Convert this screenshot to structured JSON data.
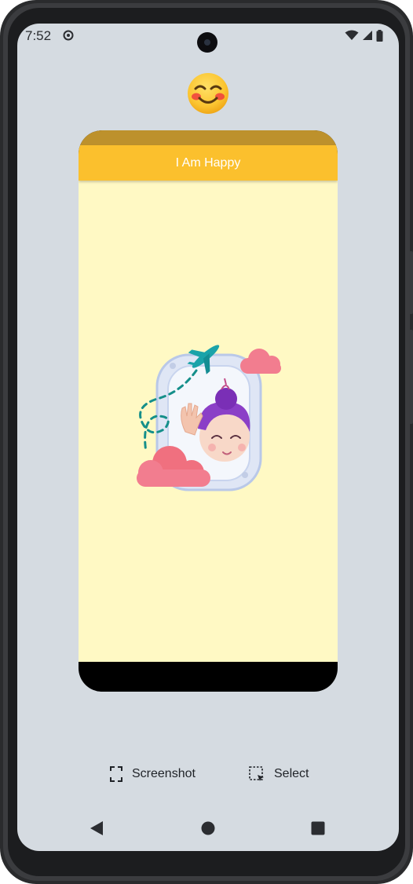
{
  "status_bar": {
    "time": "7:52",
    "icons": [
      "notification-icon",
      "wifi-icon",
      "signal-icon",
      "battery-icon"
    ]
  },
  "header_emoji": "smiling-face-emoji",
  "app": {
    "title": "I Am Happy",
    "colors": {
      "primary": "#fbc02d",
      "primary_dark": "#bd912c",
      "background": "#fff9c4"
    },
    "illustration": "girl-waving-from-airplane-window"
  },
  "toolbar": {
    "screenshot_label": "Screenshot",
    "select_label": "Select"
  },
  "nav": {
    "back": "back-icon",
    "home": "home-icon",
    "recents": "recents-icon"
  }
}
